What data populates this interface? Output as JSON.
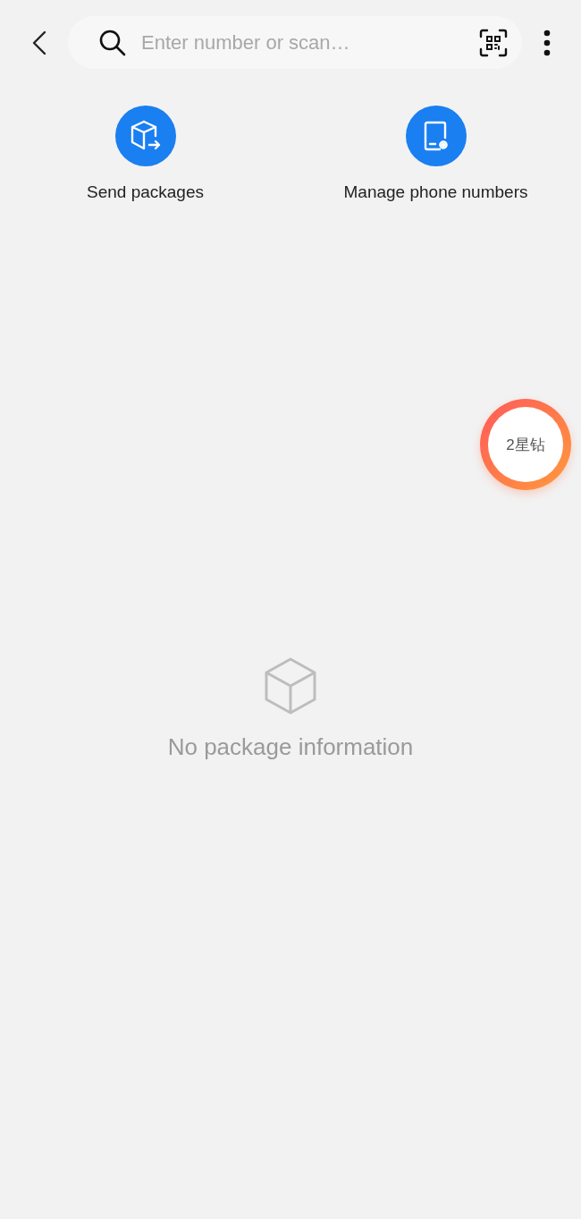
{
  "search": {
    "placeholder": "Enter number or scan…"
  },
  "actions": [
    {
      "kind": "send",
      "label": "Send packages"
    },
    {
      "kind": "phones",
      "label": "Manage phone numbers"
    }
  ],
  "floating_badge": {
    "label": "2星钻"
  },
  "empty_state": {
    "message": "No package information"
  }
}
